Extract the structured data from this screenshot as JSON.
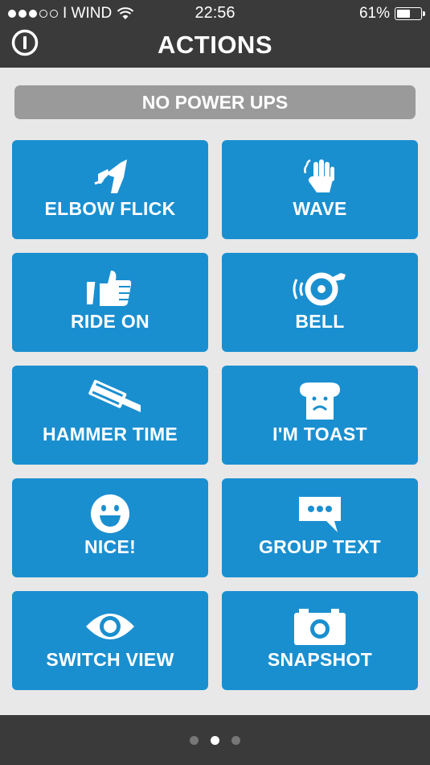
{
  "status_bar": {
    "signal_dots": [
      true,
      true,
      true,
      false,
      false
    ],
    "carrier": "I WIND",
    "time": "22:56",
    "battery_percent": "61%",
    "battery_level": 0.61
  },
  "header": {
    "title": "ACTIONS",
    "power_icon": "power-icon"
  },
  "power_ups": {
    "label": "NO POWER UPS"
  },
  "actions": [
    {
      "label": "ELBOW FLICK",
      "icon": "elbow-icon"
    },
    {
      "label": "WAVE",
      "icon": "hand-wave-icon"
    },
    {
      "label": "RIDE ON",
      "icon": "thumbs-up-icon"
    },
    {
      "label": "BELL",
      "icon": "bell-icon"
    },
    {
      "label": "HAMMER TIME",
      "icon": "hammer-icon"
    },
    {
      "label": "I'M TOAST",
      "icon": "toast-icon"
    },
    {
      "label": "NICE!",
      "icon": "smiley-icon"
    },
    {
      "label": "GROUP TEXT",
      "icon": "chat-bubble-icon"
    },
    {
      "label": "SWITCH VIEW",
      "icon": "eye-icon"
    },
    {
      "label": "SNAPSHOT",
      "icon": "camera-icon"
    }
  ],
  "pager": {
    "pages": 3,
    "active_index": 1
  },
  "colors": {
    "tile_blue": "#1a8fd0",
    "bar_dark": "#3a3a3a",
    "content_bg": "#e8e8e8",
    "powerups_gray": "#9a9a9a"
  }
}
